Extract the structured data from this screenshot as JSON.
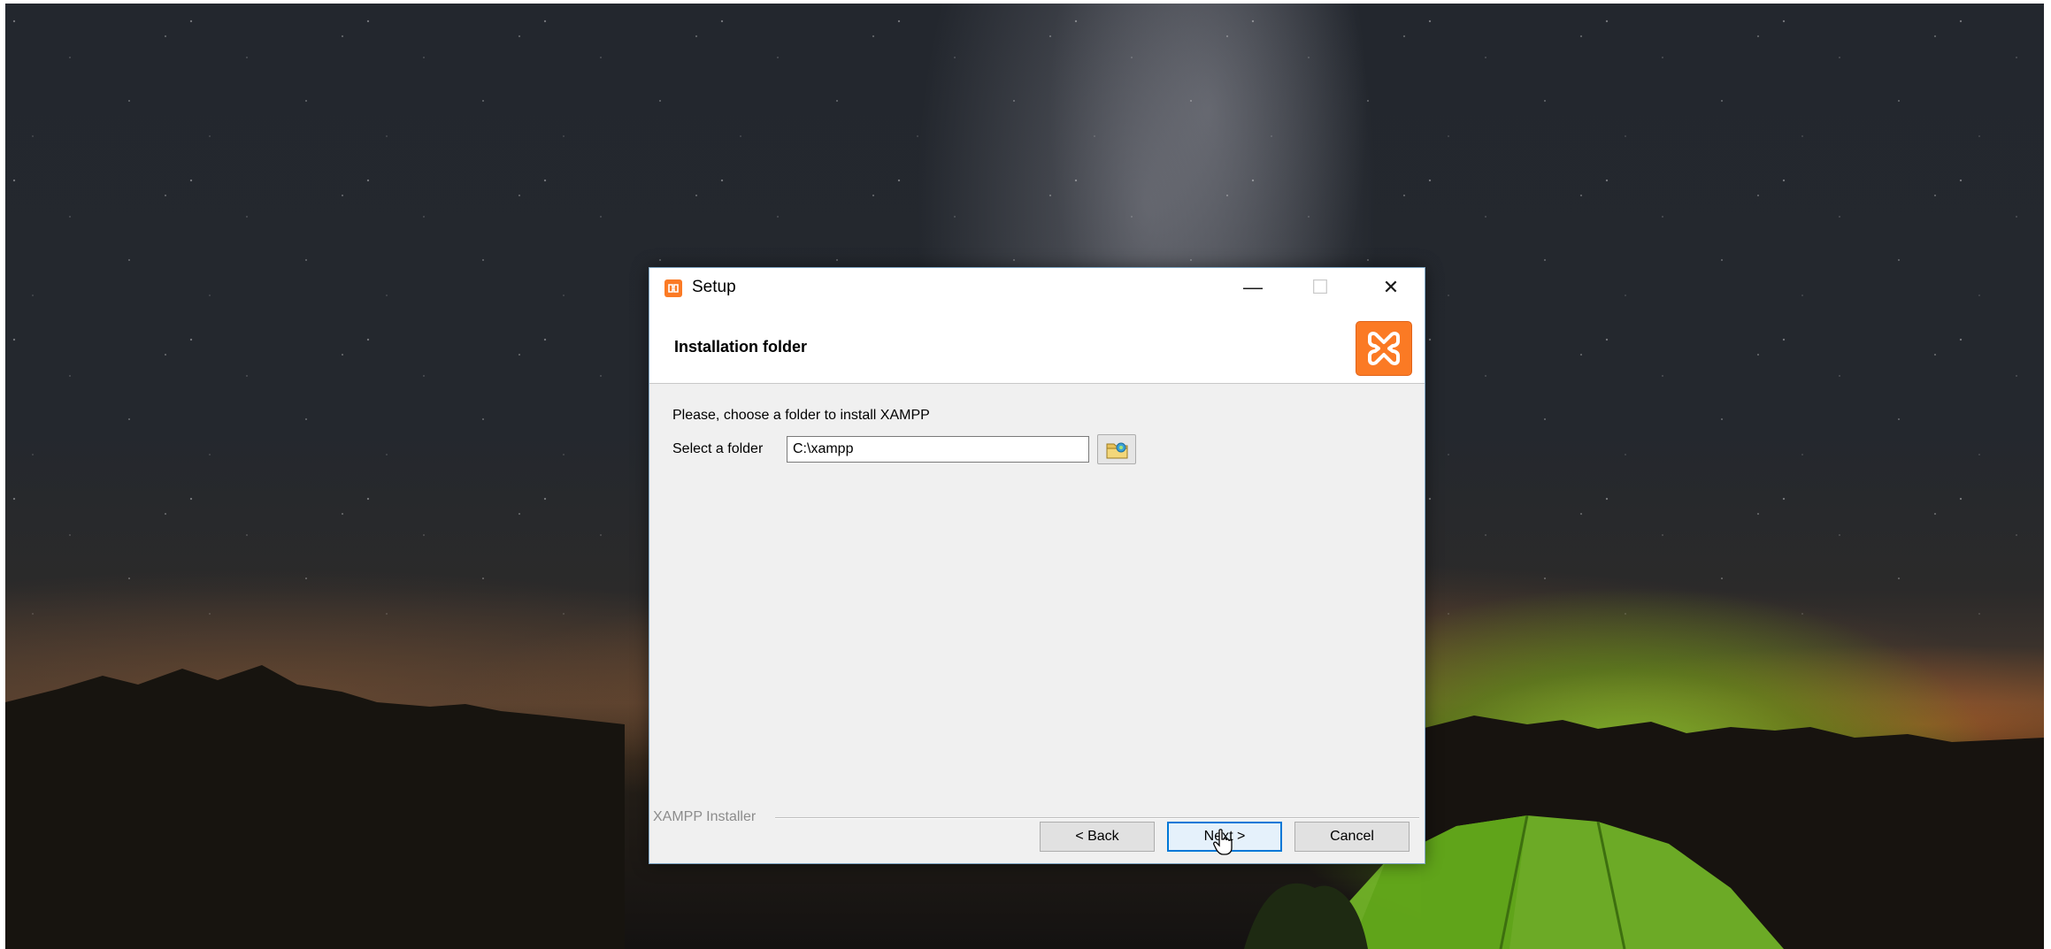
{
  "window": {
    "title": "Setup",
    "minimize_glyph": "—",
    "maximize_glyph": "☐",
    "close_glyph": "✕"
  },
  "header": {
    "title": "Installation folder",
    "logo_icon": "xampp-logo",
    "brand_color": "#fb7a24"
  },
  "content": {
    "prompt": "Please, choose a folder to install XAMPP",
    "folder_label": "Select a folder",
    "folder_value": "C:\\xampp",
    "browse_icon": "folder-browse-icon"
  },
  "footer": {
    "group_label": "XAMPP Installer",
    "back_label": "< Back",
    "next_label": "Next >",
    "cancel_label": "Cancel"
  }
}
